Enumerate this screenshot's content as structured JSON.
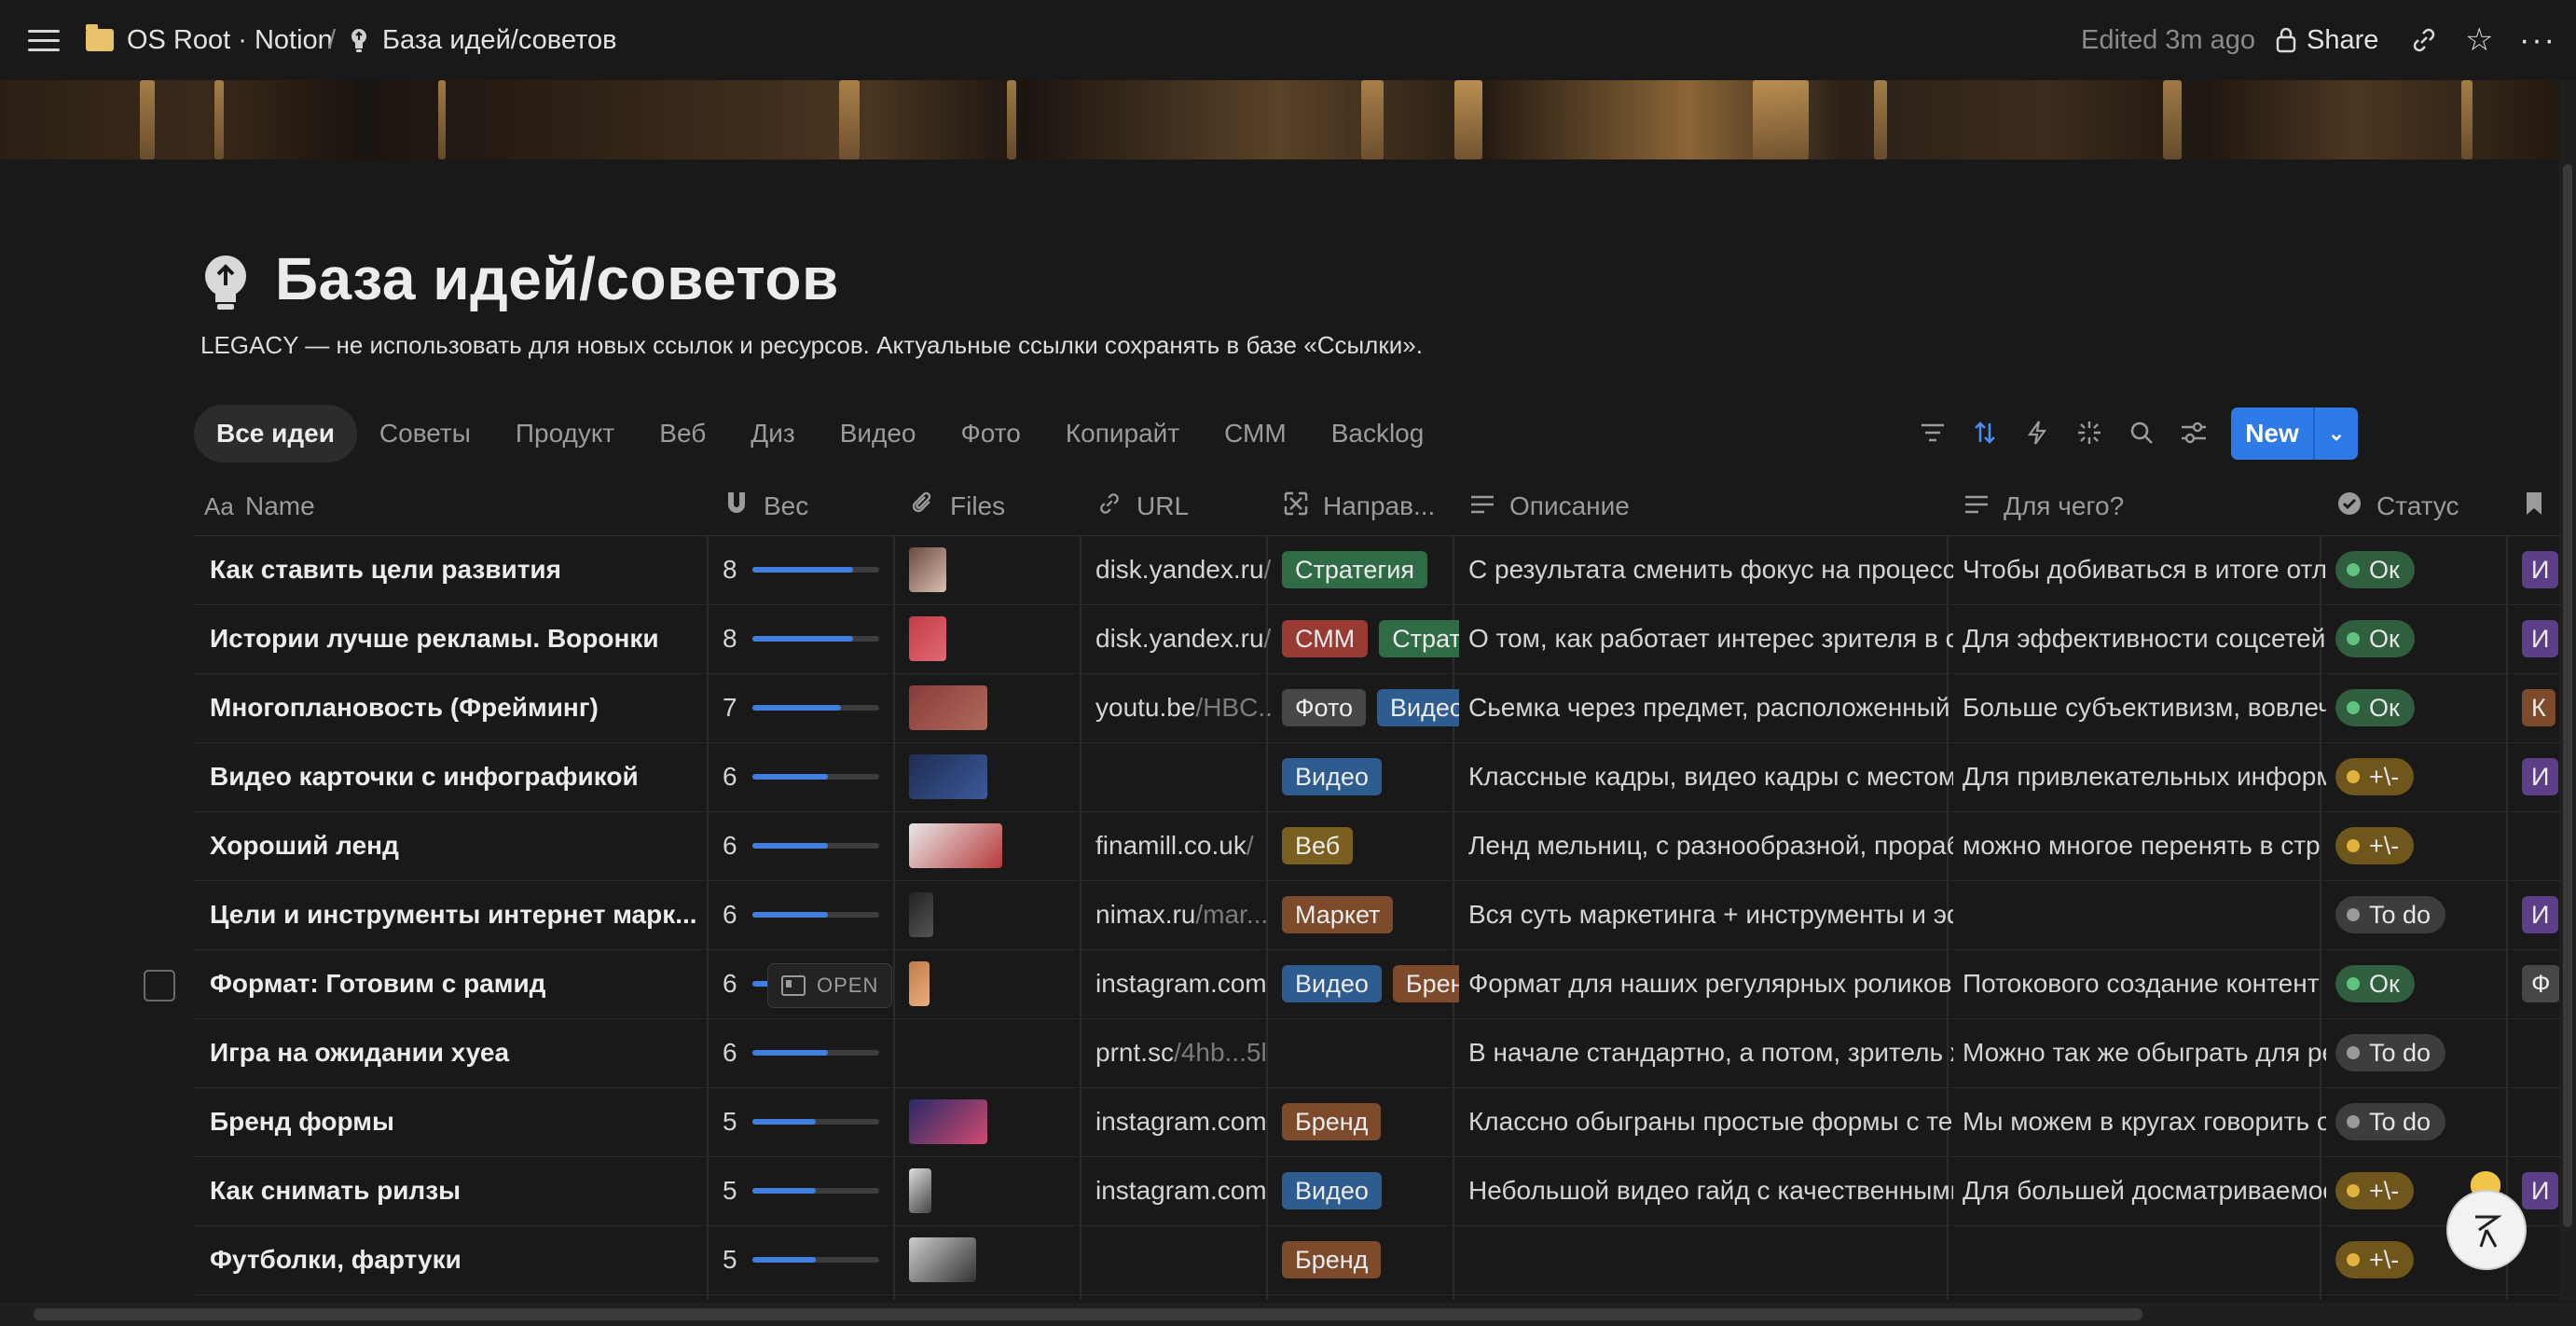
{
  "breadcrumb": {
    "workspace": "OS Root · Notion",
    "separator": "/",
    "page": "База идей/советов"
  },
  "topbar": {
    "edited": "Edited 3m ago",
    "share_label": "Share"
  },
  "page": {
    "title": "База идей/советов",
    "description": "LEGACY — не использовать для новых ссылок и ресурсов. Актуальные ссылки сохранять в базе «Ссылки»."
  },
  "tabs": [
    "Все идеи",
    "Советы",
    "Продукт",
    "Веб",
    "Диз",
    "Видео",
    "Фото",
    "Копирайт",
    "СММ",
    "Backlog"
  ],
  "toolbar": {
    "new_label": "New",
    "open_label": "OPEN"
  },
  "columns": {
    "name": "Name",
    "weight": "Вес",
    "files": "Files",
    "url": "URL",
    "direction": "Направ...",
    "description": "Описание",
    "purpose": "Для чего?",
    "status": "Статус"
  },
  "colors": {
    "accent": "#2e7ae6",
    "progress": "#3f7fe0",
    "background": "#191919"
  },
  "rows": [
    {
      "name": "Как ставить цели развития",
      "weight": "8",
      "weight_fraction": 0.8,
      "url_host": "disk.yandex.ru",
      "url_path": "/",
      "tags": [
        {
          "t": "Стратегия",
          "c": "green"
        }
      ],
      "description": "С результата сменить фокус на процесс",
      "purpose": "Чтобы добиваться в итоге отли",
      "status": "Ок",
      "status_kind": "ok",
      "extra": "И",
      "extra_color": "purple"
    },
    {
      "name": "Истории лучше рекламы. Воронки",
      "weight": "8",
      "weight_fraction": 0.8,
      "url_host": "disk.yandex.ru",
      "url_path": "/",
      "tags": [
        {
          "t": "СММ",
          "c": "red"
        },
        {
          "t": "Страт",
          "c": "green"
        }
      ],
      "description": "О том, как работает интерес зрителя в со",
      "purpose": "Для эффективности соцсетей",
      "status": "Ок",
      "status_kind": "ok",
      "extra": "И",
      "extra_color": "purple"
    },
    {
      "name": "Многоплановость (Фрейминг)",
      "weight": "7",
      "weight_fraction": 0.7,
      "url_host": "youtu.be",
      "url_path": "/HBC...",
      "tags": [
        {
          "t": "Фото",
          "c": "gray"
        },
        {
          "t": "Видео",
          "c": "blue"
        }
      ],
      "description": "Сьемка через предмет, расположенный",
      "purpose": "Больше субъективизм, вовлеч",
      "status": "Ок",
      "status_kind": "ok",
      "extra": "К",
      "extra_color": "brown"
    },
    {
      "name": "Видео карточки с инфографикой",
      "weight": "6",
      "weight_fraction": 0.6,
      "url_host": "",
      "url_path": "",
      "tags": [
        {
          "t": "Видео",
          "c": "blue"
        }
      ],
      "description": "Классные кадры, видео кадры с местом",
      "purpose": "Для привлекательных информ",
      "status": "+\\-",
      "status_kind": "mid",
      "extra": "И",
      "extra_color": "purple"
    },
    {
      "name": "Хороший ленд",
      "weight": "6",
      "weight_fraction": 0.6,
      "url_host": "finamill.co.uk",
      "url_path": "/",
      "tags": [
        {
          "t": "Веб",
          "c": "yellow"
        }
      ],
      "description": "Ленд мельниц, с разнообразной, прораб",
      "purpose": "можно многое перенять в стр",
      "status": "+\\-",
      "status_kind": "mid",
      "extra": "",
      "extra_color": ""
    },
    {
      "name": "Цели и инструменты интернет марк...",
      "weight": "6",
      "weight_fraction": 0.6,
      "url_host": "nimax.ru",
      "url_path": "/mar...",
      "tags": [
        {
          "t": "Маркет",
          "c": "brown"
        }
      ],
      "description": "Вся суть маркетинга + инструменты и эф",
      "purpose": "",
      "status": "To do",
      "status_kind": "todo",
      "extra": "И",
      "extra_color": "purple"
    },
    {
      "name": "Формат: Готовим с рамид",
      "weight": "6",
      "weight_fraction": 0.6,
      "url_host": "instagram.com",
      "url_path": "",
      "tags": [
        {
          "t": "Видео",
          "c": "blue"
        },
        {
          "t": "Бренд",
          "c": "brown"
        }
      ],
      "description": "Формат для наших регулярных роликов,",
      "purpose": "Потокового создание контент",
      "status": "Ок",
      "status_kind": "ok",
      "extra": "Ф",
      "extra_color": "gray"
    },
    {
      "name": "Игра на ожидании хуеа",
      "weight": "6",
      "weight_fraction": 0.6,
      "url_host": "prnt.sc",
      "url_path": "/4hb...5l",
      "tags": [],
      "description": "В начале стандартно, а потом, зритель ж",
      "purpose": "Можно так же обыграть для ре",
      "status": "To do",
      "status_kind": "todo",
      "extra": "",
      "extra_color": ""
    },
    {
      "name": "Бренд формы",
      "weight": "5",
      "weight_fraction": 0.5,
      "url_host": "instagram.com",
      "url_path": "",
      "tags": [
        {
          "t": "Бренд",
          "c": "brown"
        }
      ],
      "description": "Классно обыграны простые формы с тек",
      "purpose": "Мы можем в кругах говорить о",
      "status": "To do",
      "status_kind": "todo",
      "extra": "",
      "extra_color": ""
    },
    {
      "name": "Как снимать рилзы",
      "weight": "5",
      "weight_fraction": 0.5,
      "url_host": "instagram.com",
      "url_path": "",
      "tags": [
        {
          "t": "Видео",
          "c": "blue"
        }
      ],
      "description": "Небольшой видео гайд с качественными",
      "purpose": "Для большей досматриваемос",
      "status": "+\\-",
      "status_kind": "mid",
      "extra": "И",
      "extra_color": "purple"
    },
    {
      "name": "Футболки, фартуки",
      "weight": "5",
      "weight_fraction": 0.5,
      "url_host": "",
      "url_path": "",
      "tags": [
        {
          "t": "Бренд",
          "c": "brown"
        }
      ],
      "description": "",
      "purpose": "",
      "status": "+\\-",
      "status_kind": "mid",
      "extra": "",
      "extra_color": ""
    }
  ]
}
